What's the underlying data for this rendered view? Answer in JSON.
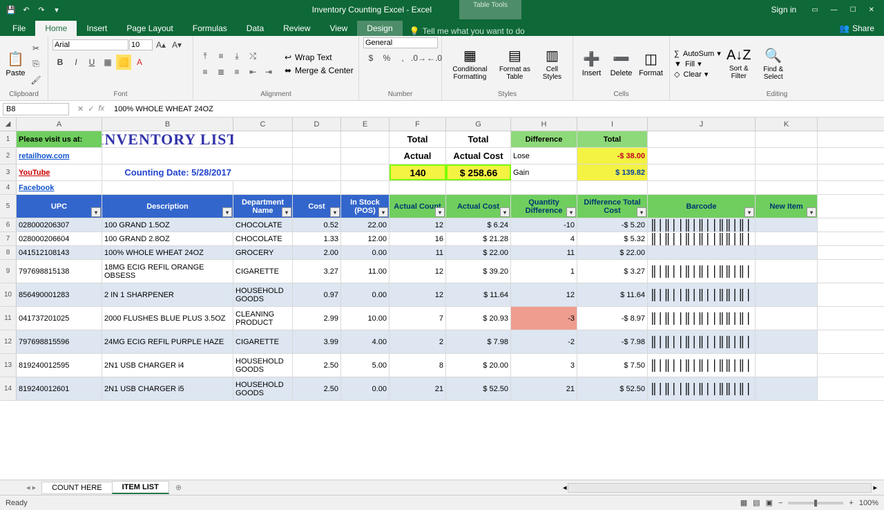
{
  "app": {
    "title": "Inventory Counting Excel - Excel",
    "tool_context": "Table Tools",
    "signin": "Sign in"
  },
  "tabs": {
    "file": "File",
    "home": "Home",
    "insert": "Insert",
    "page_layout": "Page Layout",
    "formulas": "Formulas",
    "data": "Data",
    "review": "Review",
    "view": "View",
    "design": "Design",
    "tell_me": "Tell me what you want to do",
    "share": "Share"
  },
  "ribbon": {
    "clipboard": "Clipboard",
    "paste": "Paste",
    "font": "Font",
    "font_name": "Arial",
    "font_size": "10",
    "alignment": "Alignment",
    "wrap_text": "Wrap Text",
    "merge_center": "Merge & Center",
    "number": "Number",
    "number_format": "General",
    "styles": "Styles",
    "cond_fmt": "Conditional Formatting",
    "fmt_table": "Format as Table",
    "cell_styles": "Cell Styles",
    "cells": "Cells",
    "insert_btn": "Insert",
    "delete_btn": "Delete",
    "format_btn": "Format",
    "editing": "Editing",
    "autosum": "AutoSum",
    "fill": "Fill",
    "clear": "Clear",
    "sort_filter": "Sort & Filter",
    "find_select": "Find & Select"
  },
  "fxbar": {
    "namebox": "B8",
    "formula": "100% WHOLE WHEAT 24OZ"
  },
  "columns": [
    "A",
    "B",
    "C",
    "D",
    "E",
    "F",
    "G",
    "H",
    "I",
    "J",
    "K"
  ],
  "topbox": {
    "visit": "Please visit us at:",
    "links": [
      "retailhow.com",
      "YouTube",
      "Facebook"
    ],
    "title": "INVENTORY LIST",
    "counting_date_label": "Counting Date:",
    "counting_date": "5/28/2017",
    "total_actual_hdr": "Total Actual",
    "total_actual_cost_hdr": "Total Actual Cost",
    "total_actual": "140",
    "total_actual_cost": "$   258.66",
    "difference": "Difference",
    "total": "Total",
    "lose_label": "Lose",
    "lose_val": "-$     38.00",
    "gain_label": "Gain",
    "gain_val": "$   139.82"
  },
  "headers": {
    "upc": "UPC",
    "desc": "Description",
    "dept": "Department Name",
    "cost": "Cost",
    "instock": "In Stock (POS)",
    "actual_count": "Actual Count",
    "actual_cost": "Actual Cost",
    "qty_diff": "Quantity Difference",
    "diff_total": "Difference Total Cost",
    "barcode": "Barcode",
    "new_item": "New Item"
  },
  "rows": [
    {
      "n": 6,
      "upc": "028000206307",
      "desc": "100 GRAND 1.5OZ",
      "dept": "CHOCOLATE",
      "cost": "0.52",
      "instock": "22.00",
      "ac": "12",
      "acost": "$          6.24",
      "qd": "-10",
      "dtc": "-$          5.20",
      "neg": true,
      "bc": true
    },
    {
      "n": 7,
      "upc": "028000206604",
      "desc": "100 GRAND 2.8OZ",
      "dept": "CHOCOLATE",
      "cost": "1.33",
      "instock": "12.00",
      "ac": "16",
      "acost": "$        21.28",
      "qd": "4",
      "dtc": "$          5.32",
      "neg": false,
      "bc": true
    },
    {
      "n": 8,
      "upc": "041512108143",
      "desc": "100% WHOLE WHEAT 24OZ",
      "dept": "GROCERY",
      "cost": "2.00",
      "instock": "0.00",
      "ac": "11",
      "acost": "$        22.00",
      "qd": "11",
      "dtc": "$        22.00",
      "neg": false,
      "bc": false
    },
    {
      "n": 9,
      "upc": "797698815138",
      "desc": "18MG ECIG REFIL ORANGE OBSESS",
      "dept": "CIGARETTE",
      "cost": "3.27",
      "instock": "11.00",
      "ac": "12",
      "acost": "$        39.20",
      "qd": "1",
      "dtc": "$          3.27",
      "neg": false,
      "bc": true
    },
    {
      "n": 10,
      "upc": "856490001283",
      "desc": "2 IN 1 SHARPENER",
      "dept": "HOUSEHOLD GOODS",
      "cost": "0.97",
      "instock": "0.00",
      "ac": "12",
      "acost": "$        11.64",
      "qd": "12",
      "dtc": "$        11.64",
      "neg": false,
      "bc": true
    },
    {
      "n": 11,
      "upc": "041737201025",
      "desc": "2000 FLUSHES BLUE PLUS 3.5OZ",
      "dept": "CLEANING PRODUCT",
      "cost": "2.99",
      "instock": "10.00",
      "ac": "7",
      "acost": "$        20.93",
      "qd": "-3",
      "dtc": "-$          8.97",
      "neg": true,
      "bc": true
    },
    {
      "n": 12,
      "upc": "797698815596",
      "desc": "24MG ECIG REFIL PURPLE HAZE",
      "dept": "CIGARETTE",
      "cost": "3.99",
      "instock": "4.00",
      "ac": "2",
      "acost": "$          7.98",
      "qd": "-2",
      "dtc": "-$          7.98",
      "neg": true,
      "bc": true
    },
    {
      "n": 13,
      "upc": "819240012595",
      "desc": "2N1 USB CHARGER i4",
      "dept": "HOUSEHOLD GOODS",
      "cost": "2.50",
      "instock": "5.00",
      "ac": "8",
      "acost": "$        20.00",
      "qd": "3",
      "dtc": "$          7.50",
      "neg": false,
      "bc": true
    },
    {
      "n": 14,
      "upc": "819240012601",
      "desc": "2N1 USB CHARGER i5",
      "dept": "HOUSEHOLD GOODS",
      "cost": "2.50",
      "instock": "0.00",
      "ac": "21",
      "acost": "$        52.50",
      "qd": "21",
      "dtc": "$        52.50",
      "neg": false,
      "bc": true
    }
  ],
  "sheets": {
    "tab1": "COUNT HERE",
    "tab2": "ITEM LIST"
  },
  "status": {
    "ready": "Ready",
    "zoom": "100%"
  }
}
